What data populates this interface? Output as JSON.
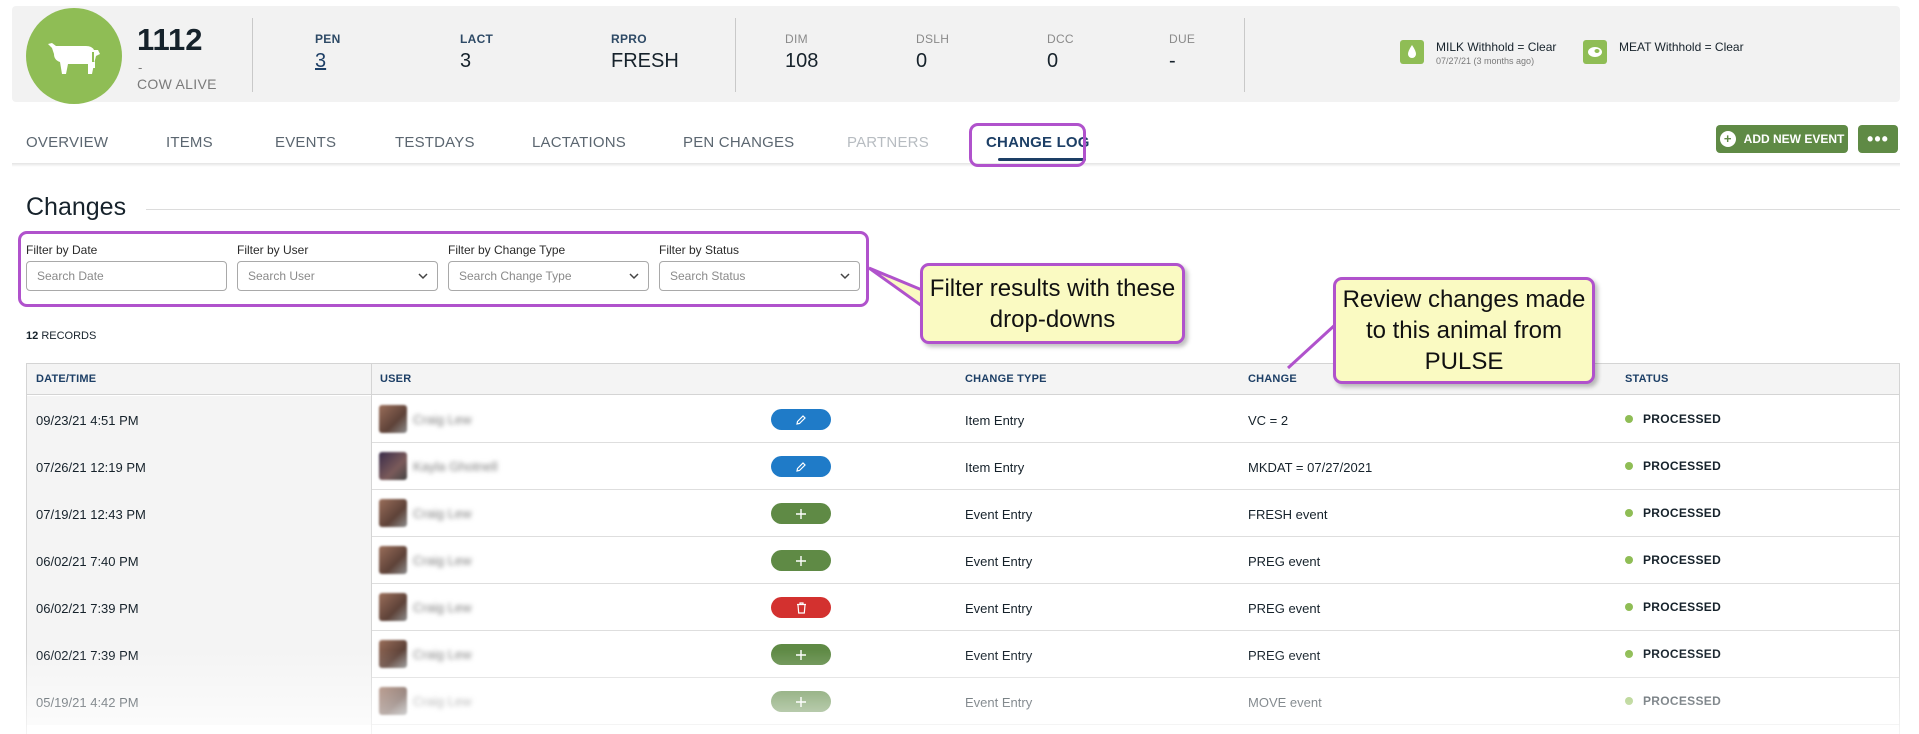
{
  "animal": {
    "id": "1112",
    "dash": "-",
    "status": "COW ALIVE",
    "icon": "cow-icon"
  },
  "stats": [
    {
      "label": "PEN",
      "value": "3"
    },
    {
      "label": "LACT",
      "value": "3"
    },
    {
      "label": "RPRO",
      "value": "FRESH"
    },
    {
      "label": "DIM",
      "value": "108"
    },
    {
      "label": "DSLH",
      "value": "0"
    },
    {
      "label": "DCC",
      "value": "0"
    },
    {
      "label": "DUE",
      "value": "-"
    }
  ],
  "withholds": {
    "milk": {
      "title": "MILK Withhold = Clear",
      "sub": "07/27/21 (3 months ago)",
      "icon": "milk-drop-icon"
    },
    "meat": {
      "title": "MEAT Withhold = Clear",
      "icon": "meat-icon"
    }
  },
  "tabs": [
    {
      "label": "OVERVIEW"
    },
    {
      "label": "ITEMS"
    },
    {
      "label": "EVENTS"
    },
    {
      "label": "TESTDAYS"
    },
    {
      "label": "LACTATIONS"
    },
    {
      "label": "PEN CHANGES"
    },
    {
      "label": "PARTNERS"
    },
    {
      "label": "CHANGE LOG"
    }
  ],
  "actions": {
    "add_event": "ADD NEW EVENT",
    "more": "•••"
  },
  "section": {
    "title": "Changes"
  },
  "filters": [
    {
      "label": "Filter by Date",
      "placeholder": "Search Date"
    },
    {
      "label": "Filter by User",
      "placeholder": "Search User"
    },
    {
      "label": "Filter by Change Type",
      "placeholder": "Search Change Type"
    },
    {
      "label": "Filter by Status",
      "placeholder": "Search Status"
    }
  ],
  "records": {
    "count": "12",
    "label": "RECORDS"
  },
  "table": {
    "headers": {
      "datetime": "DATE/TIME",
      "user": "USER",
      "change_type": "CHANGE TYPE",
      "change": "CHANGE",
      "status": "STATUS"
    },
    "rows": [
      {
        "datetime": "09/23/21 4:51 PM",
        "user": "Craig Lew",
        "action": "edit",
        "change_type": "Item Entry",
        "change": "VC = 2",
        "status": "PROCESSED"
      },
      {
        "datetime": "07/26/21 12:19 PM",
        "user": "Kayla Ghotnell",
        "action": "edit",
        "change_type": "Item Entry",
        "change": "MKDAT = 07/27/2021",
        "status": "PROCESSED"
      },
      {
        "datetime": "07/19/21 12:43 PM",
        "user": "Craig Lew",
        "action": "add",
        "change_type": "Event Entry",
        "change": "FRESH event",
        "status": "PROCESSED"
      },
      {
        "datetime": "06/02/21 7:40 PM",
        "user": "Craig Lew",
        "action": "add",
        "change_type": "Event Entry",
        "change": "PREG event",
        "status": "PROCESSED"
      },
      {
        "datetime": "06/02/21 7:39 PM",
        "user": "Craig Lew",
        "action": "delete",
        "change_type": "Event Entry",
        "change": "PREG event",
        "status": "PROCESSED"
      },
      {
        "datetime": "06/02/21 7:39 PM",
        "user": "Craig Lew",
        "action": "add",
        "change_type": "Event Entry",
        "change": "PREG event",
        "status": "PROCESSED"
      },
      {
        "datetime": "05/19/21 4:42 PM",
        "user": "Craig Lew",
        "action": "add",
        "change_type": "Event Entry",
        "change": "MOVE event",
        "status": "PROCESSED"
      }
    ]
  },
  "callouts": {
    "filter": "Filter results with these drop-downs",
    "review": "Review changes made to this animal from PULSE"
  },
  "colors": {
    "accent_green": "#8fbd55",
    "button_green": "#5f8a45",
    "edit_blue": "#1f7bc8",
    "delete_red": "#d3312f",
    "callout_border": "#b052cc",
    "callout_fill": "#fafac2",
    "nav_blue": "#1d3f66"
  }
}
